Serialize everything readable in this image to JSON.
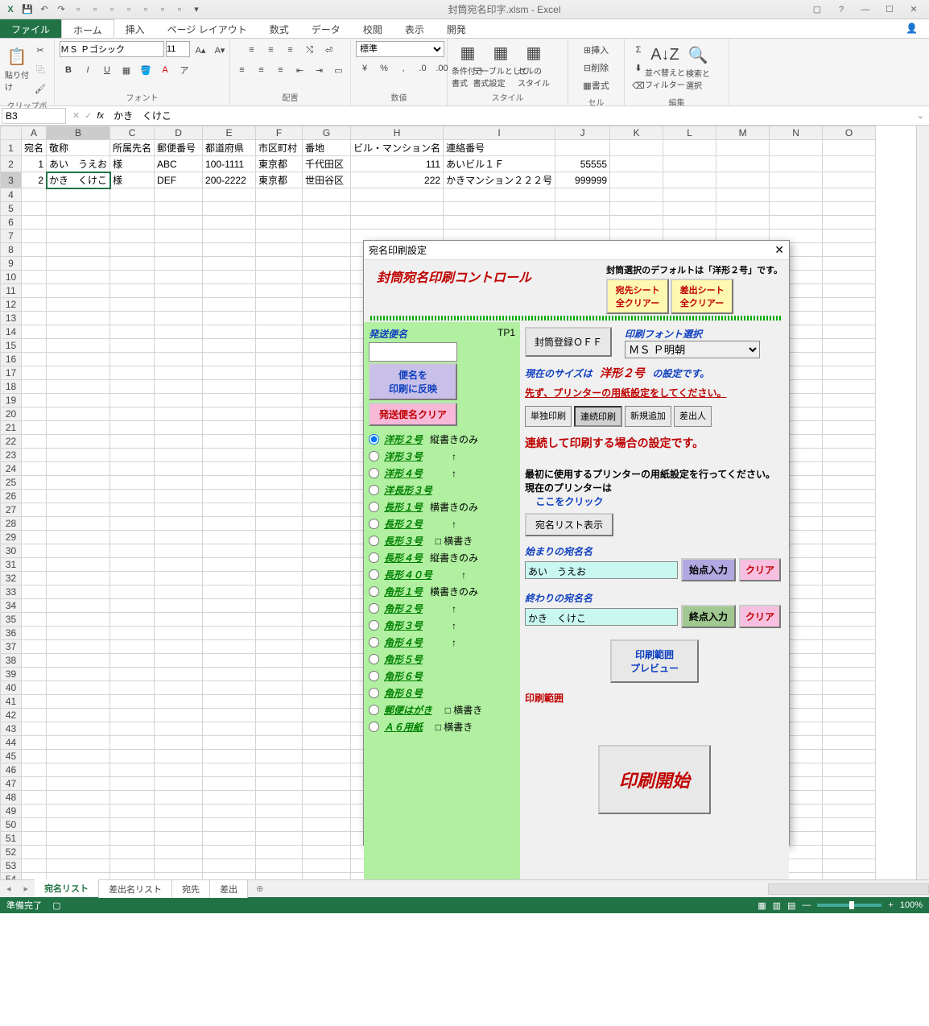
{
  "titlebar": {
    "filename": "封筒宛名印字.xlsm - Excel"
  },
  "ribbon_tabs": [
    "ファイル",
    "ホーム",
    "挿入",
    "ページ レイアウト",
    "数式",
    "データ",
    "校閲",
    "表示",
    "開発"
  ],
  "ribbon": {
    "clipboard": {
      "label": "クリップボード",
      "paste": "貼り付け"
    },
    "font": {
      "label": "フォント",
      "name": "ＭＳ Ｐゴシック",
      "size": "11"
    },
    "align": {
      "label": "配置"
    },
    "number": {
      "label": "数値",
      "format": "標準"
    },
    "style": {
      "label": "スタイル",
      "cond": "条件付き\n書式",
      "table": "テーブルとして\n書式設定",
      "cell": "セルの\nスタイル"
    },
    "cells": {
      "label": "セル",
      "insert": "挿入",
      "delete": "削除",
      "format": "書式"
    },
    "edit": {
      "label": "編集",
      "sort": "並べ替えと\nフィルター",
      "find": "検索と\n選択"
    }
  },
  "formula_bar": {
    "namebox": "B3",
    "fx": "fx",
    "value": "かき　くけこ"
  },
  "columns": [
    "",
    "A",
    "B",
    "C",
    "D",
    "E",
    "F",
    "G",
    "H",
    "I",
    "J",
    "K",
    "L",
    "M",
    "N",
    "O"
  ],
  "headers": [
    "",
    "宛名",
    "敬称",
    "所属先名",
    "郵便番号",
    "都道府県",
    "市区町村",
    "番地",
    "ビル・マンション名",
    "連絡番号"
  ],
  "rows": [
    {
      "n": 1,
      "d": [
        "1",
        "あい　うえお",
        "様",
        "ABC",
        "100-1111",
        "東京都",
        "千代田区",
        "111",
        "あいビル１Ｆ",
        "55555"
      ]
    },
    {
      "n": 2,
      "d": [
        "2",
        "かき　くけこ",
        "様",
        "DEF",
        "200-2222",
        "東京都",
        "世田谷区",
        "222",
        "かきマンション２２２号",
        "999999"
      ]
    }
  ],
  "row_count": 56,
  "selected_cell": "B3",
  "dialog": {
    "title": "宛名印刷設定",
    "main_title": "封筒宛名印刷コントロール",
    "default_note": "封筒選択のデフォルトは「洋形２号」です。",
    "btn_clear_dest": "宛先シート\n全クリアー",
    "btn_clear_sender": "差出シート\n全クリアー",
    "shipping_label": "発送便名",
    "tp": "TP1",
    "btn_reflect": "便名を\n印刷に反映",
    "btn_clear_ship": "発送便名クリア",
    "env_types": [
      {
        "name": "洋形２号",
        "note": "縦書きのみ"
      },
      {
        "name": "洋形３号",
        "note": "↑"
      },
      {
        "name": "洋形４号",
        "note": "↑"
      },
      {
        "name": "洋長形３号",
        "note": ""
      },
      {
        "name": "長形１号",
        "note": "横書きのみ"
      },
      {
        "name": "長形２号",
        "note": "↑"
      },
      {
        "name": "長形３号",
        "note": "□ 横書き"
      },
      {
        "name": "長形４号",
        "note": "縦書きのみ"
      },
      {
        "name": "長形４０号",
        "note": "↑"
      },
      {
        "name": "角形１号",
        "note": "横書きのみ"
      },
      {
        "name": "角形２号",
        "note": "↑"
      },
      {
        "name": "角形３号",
        "note": "↑"
      },
      {
        "name": "角形４号",
        "note": "↑"
      },
      {
        "name": "角形５号",
        "note": ""
      },
      {
        "name": "角形６号",
        "note": ""
      },
      {
        "name": "角形８号",
        "note": ""
      },
      {
        "name": "郵便はがき",
        "note": "□ 横書き"
      },
      {
        "name": "Ａ６用紙",
        "note": "□ 横書き"
      }
    ],
    "btn_env_off": "封筒登録ＯＦＦ",
    "font_label": "印刷フォント選択",
    "font_value": "ＭＳ Ｐ明朝",
    "size_lbl": "現在のサイズは",
    "size_val": "洋形２号",
    "size_suffix": "の設定です。",
    "printer_note": "先ず、プリンターの用紙設定をしてください。",
    "tabs": [
      "単独印刷",
      "連続印刷",
      "新規追加",
      "差出人"
    ],
    "active_tab": 1,
    "cont_note": "連続して印刷する場合の設定です。",
    "printer_inst": "最初に使用するプリンターの用紙設定を行ってください。\n現在のプリンターは",
    "printer_link": "ここをクリック",
    "btn_list": "宛名リスト表示",
    "start_lbl": "始まりの宛名名",
    "start_val": "あい　うえお",
    "btn_start": "始点入力",
    "btn_clear": "クリア",
    "end_lbl": "終わりの宛名名",
    "end_val": "かき　くけこ",
    "btn_end": "終点入力",
    "btn_preview": "印刷範囲\nプレビュー",
    "range_lbl": "印刷範囲",
    "btn_print": "印刷開始"
  },
  "sheets": [
    "宛名リスト",
    "差出名リスト",
    "宛先",
    "差出"
  ],
  "active_sheet": 0,
  "status": {
    "ready": "準備完了",
    "zoom": "100%"
  }
}
